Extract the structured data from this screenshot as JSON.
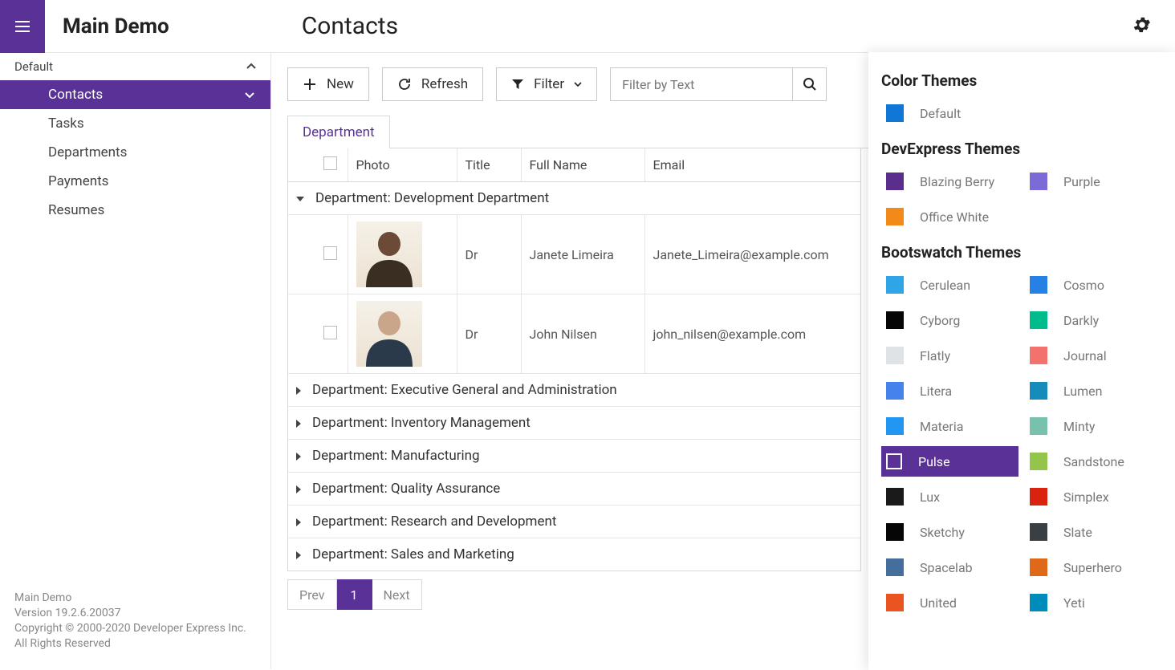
{
  "header": {
    "app_title": "Main Demo",
    "page_title": "Contacts"
  },
  "sidebar": {
    "header": "Default",
    "items": [
      {
        "label": "Contacts",
        "active": true
      },
      {
        "label": "Tasks"
      },
      {
        "label": "Departments"
      },
      {
        "label": "Payments"
      },
      {
        "label": "Resumes"
      }
    ],
    "footer": {
      "line1": "Main Demo",
      "line2": "Version 19.2.6.20037",
      "line3": "Copyright © 2000-2020 Developer Express Inc.",
      "line4": "All Rights Reserved"
    }
  },
  "toolbar": {
    "new_label": "New",
    "refresh_label": "Refresh",
    "filter_label": "Filter",
    "filter_placeholder": "Filter by Text"
  },
  "tabs": {
    "department": "Department"
  },
  "grid": {
    "columns": {
      "photo": "Photo",
      "title": "Title",
      "full_name": "Full Name",
      "email": "Email"
    },
    "groups": [
      {
        "label": "Department: Development Department",
        "expanded": true,
        "rows": [
          {
            "title": "Dr",
            "full_name": "Janete Limeira",
            "email": "Janete_Limeira@example.com"
          },
          {
            "title": "Dr",
            "full_name": "John Nilsen",
            "email": "john_nilsen@example.com"
          }
        ]
      },
      {
        "label": "Department: Executive General and Administration",
        "expanded": false
      },
      {
        "label": "Department: Inventory Management",
        "expanded": false
      },
      {
        "label": "Department: Manufacturing",
        "expanded": false
      },
      {
        "label": "Department: Quality Assurance",
        "expanded": false
      },
      {
        "label": "Department: Research and Development",
        "expanded": false
      },
      {
        "label": "Department: Sales and Marketing",
        "expanded": false
      }
    ]
  },
  "pagination": {
    "prev": "Prev",
    "page": "1",
    "next": "Next"
  },
  "themes": {
    "section1": "Color Themes",
    "color_themes": [
      {
        "name": "Default",
        "color": "#1177d7"
      }
    ],
    "section2": "DevExpress Themes",
    "devexpress": [
      {
        "name": "Blazing Berry",
        "color": "#5a2e8c"
      },
      {
        "name": "Purple",
        "color": "#7b6bd6"
      },
      {
        "name": "Office White",
        "color": "#f28a1a"
      }
    ],
    "section3": "Bootswatch Themes",
    "bootswatch": [
      {
        "name": "Cerulean",
        "color": "#2fa4e7"
      },
      {
        "name": "Cosmo",
        "color": "#2780e3"
      },
      {
        "name": "Cyborg",
        "color": "#060606"
      },
      {
        "name": "Darkly",
        "color": "#00bc8c"
      },
      {
        "name": "Flatly",
        "color": "#e0e3e6"
      },
      {
        "name": "Journal",
        "color": "#f4726d"
      },
      {
        "name": "Litera",
        "color": "#4582ec"
      },
      {
        "name": "Lumen",
        "color": "#158cba"
      },
      {
        "name": "Materia",
        "color": "#2196f3"
      },
      {
        "name": "Minty",
        "color": "#78c2ad"
      },
      {
        "name": "Pulse",
        "color": "#593196",
        "selected": true
      },
      {
        "name": "Sandstone",
        "color": "#93c54b"
      },
      {
        "name": "Lux",
        "color": "#1a1a1a"
      },
      {
        "name": "Simplex",
        "color": "#d9230f"
      },
      {
        "name": "Sketchy",
        "color": "#060606"
      },
      {
        "name": "Slate",
        "color": "#3a3f44"
      },
      {
        "name": "Spacelab",
        "color": "#446e9b"
      },
      {
        "name": "Superhero",
        "color": "#df6919"
      },
      {
        "name": "United",
        "color": "#e95420"
      },
      {
        "name": "Yeti",
        "color": "#008cba"
      }
    ]
  }
}
